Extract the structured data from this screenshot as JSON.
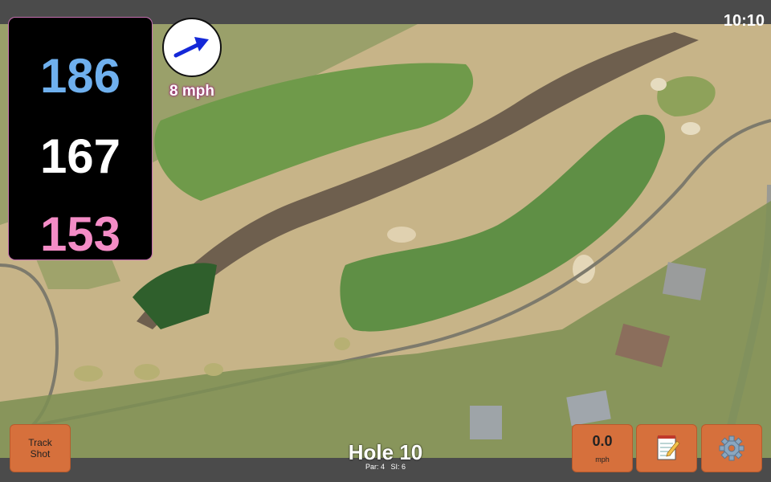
{
  "status_bar": {
    "time": "10:10"
  },
  "distances": {
    "back": "186",
    "middle": "167",
    "front": "153"
  },
  "wind": {
    "speed": "8 mph",
    "icon": "wind-arrow-icon"
  },
  "hole": {
    "title": "Hole 10",
    "par_label": "Par: 4",
    "si_label": "SI: 6"
  },
  "buttons": {
    "track_shot": {
      "line1": "Track",
      "line2": "Shot"
    },
    "speed": {
      "value": "0.0",
      "unit": "mph"
    },
    "notes_icon": "notepad-icon",
    "settings_icon": "gear-icon"
  },
  "colors": {
    "button": "#d6703c",
    "back_distance": "#6fb0ee",
    "middle_distance": "#ffffff",
    "front_distance": "#f48cc6",
    "wind_text_outline": "#a0147a"
  }
}
